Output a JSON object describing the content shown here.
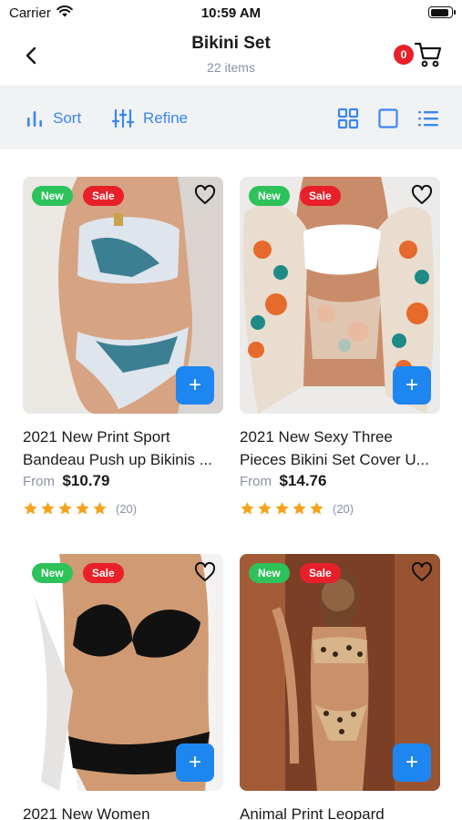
{
  "status": {
    "carrier": "Carrier",
    "time": "10:59 AM",
    "battery_level": 0.9
  },
  "header": {
    "title": "Bikini Set",
    "subtitle": "22 items",
    "cart_count": "0"
  },
  "toolbar": {
    "sort_label": "Sort",
    "refine_label": "Refine"
  },
  "colors": {
    "accent": "#1d86f0",
    "new_badge": "#2ec25a",
    "sale_badge": "#e8202a",
    "star": "#f6a21b",
    "muted": "#8a92a6"
  },
  "products": [
    {
      "badge_new": "New",
      "badge_sale": "Sale",
      "name_line1": "2021 New Print Sport",
      "name_line2": "Bandeau Push up Bikinis ...",
      "price_prefix": "From",
      "price": "$10.79",
      "rating": 5,
      "reviews": "(20)"
    },
    {
      "badge_new": "New",
      "badge_sale": "Sale",
      "name_line1": "2021 New Sexy Three",
      "name_line2": "Pieces Bikini Set Cover U...",
      "price_prefix": "From",
      "price": "$14.76",
      "rating": 5,
      "reviews": "(20)"
    },
    {
      "badge_new": "New",
      "badge_sale": "Sale",
      "name_line1": "2021 New Women",
      "name_line2": ""
    },
    {
      "badge_new": "New",
      "badge_sale": "Sale",
      "name_line1": "Animal Print Leopard",
      "name_line2": ""
    }
  ]
}
